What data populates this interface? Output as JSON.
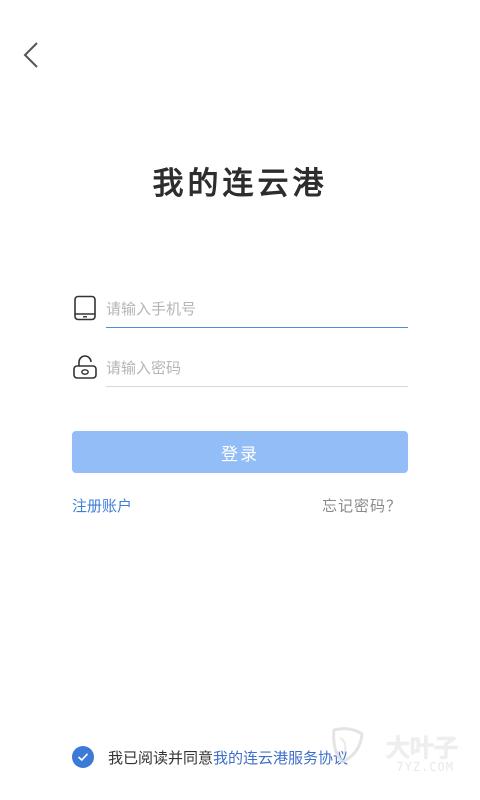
{
  "app": {
    "title": "我的连云港"
  },
  "form": {
    "phone_placeholder": "请输入手机号",
    "password_placeholder": "请输入密码",
    "login_label": "登录"
  },
  "links": {
    "register": "注册账户",
    "forgot_password": "忘记密码？"
  },
  "agreement": {
    "checked": true,
    "prefix": "我已阅读并同意",
    "link_text": "我的连云港服务协议"
  },
  "watermark": {
    "name": "大叶子",
    "site": "7YZ.COM"
  },
  "colors": {
    "accent": "#3c7ad8",
    "button": "#93bdf6",
    "link": "#3f7fd6",
    "muted": "#8a8a8a"
  },
  "icons": {
    "back": "chevron-left-icon",
    "phone": "phone-icon",
    "password": "lock-icon",
    "check": "check-icon"
  }
}
